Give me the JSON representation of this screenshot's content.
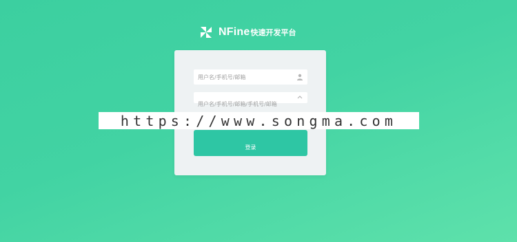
{
  "brand": {
    "name": "NFine",
    "subtitle": "快速开发平台",
    "logo_icon": "pinwheel-logo-icon"
  },
  "login_form": {
    "username_placeholder": "用户名/手机号/邮箱",
    "password_placeholder": "用户名/手机号/邮箱/手机号/邮箱",
    "submit_label": "登录",
    "user_icon": "user-icon",
    "dropdown_icon": "chevron-up-icon"
  },
  "watermark": {
    "text": "https://www.songma.com"
  },
  "colors": {
    "background_start": "#3ccfa0",
    "background_end": "#5ee1ab",
    "button": "#2ec6a4",
    "card": "#eef2f3"
  }
}
